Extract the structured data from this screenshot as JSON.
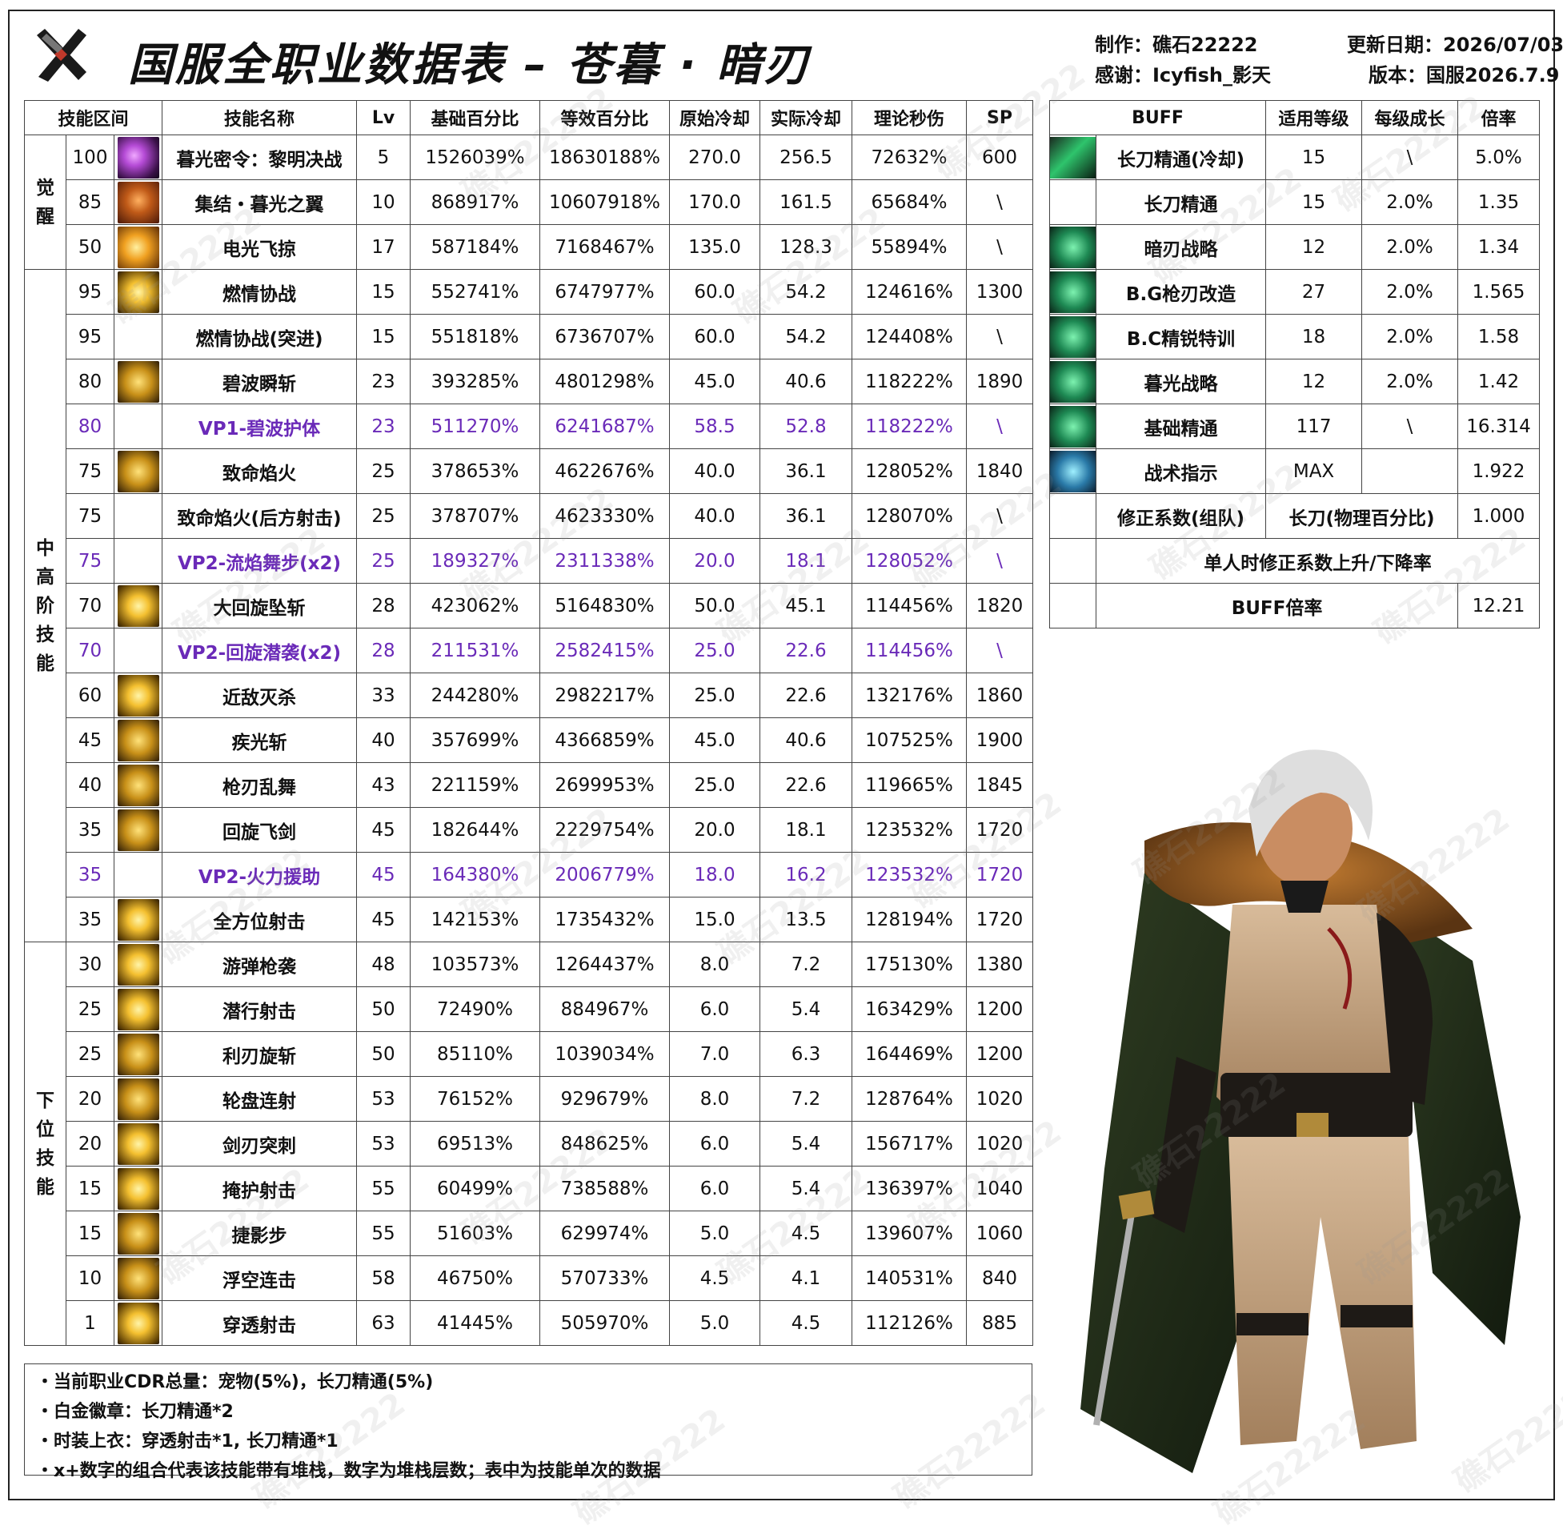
{
  "header": {
    "title": "国服全职业数据表 – 苍暮 · 暗刃",
    "author": "制作：礁石22222",
    "thanks": "感谢：Icyfish_影天",
    "update": "更新日期：2026/07/03",
    "version": "版本：国服2026.7.9"
  },
  "skills_table": {
    "headers": [
      "技能区间",
      "技能名称",
      "Lv",
      "基础百分比",
      "等效百分比",
      "原始冷却",
      "实际冷却",
      "理论秒伤",
      "SP"
    ],
    "groups": [
      {
        "label_chars": [
          "觉",
          "醒"
        ],
        "rows": 3
      },
      {
        "label_chars": [
          "中",
          "高",
          "阶",
          "技",
          "能"
        ],
        "rows": 15
      },
      {
        "label_chars": [
          "下",
          "位",
          "技",
          "能"
        ],
        "rows": 9
      }
    ],
    "rows": [
      {
        "level": "100",
        "icon": "sk1",
        "name": "暮光密令：黎明决战",
        "lv": "5",
        "base": "1526039%",
        "equiv": "18630188%",
        "cd": "270.0",
        "real_cd": "256.5",
        "dps": "72632%",
        "sp": "600",
        "vp": false
      },
      {
        "level": "85",
        "icon": "sk2",
        "name": "集结・暮光之翼",
        "lv": "10",
        "base": "868917%",
        "equiv": "10607918%",
        "cd": "170.0",
        "real_cd": "161.5",
        "dps": "65684%",
        "sp": "\\",
        "vp": false
      },
      {
        "level": "50",
        "icon": "sk3",
        "name": "电光飞掠",
        "lv": "17",
        "base": "587184%",
        "equiv": "7168467%",
        "cd": "135.0",
        "real_cd": "128.3",
        "dps": "55894%",
        "sp": "\\",
        "vp": false
      },
      {
        "level": "95",
        "icon": "sk4",
        "name": "燃情协战",
        "lv": "15",
        "base": "552741%",
        "equiv": "6747977%",
        "cd": "60.0",
        "real_cd": "54.2",
        "dps": "124616%",
        "sp": "1300",
        "vp": false
      },
      {
        "level": "95",
        "icon": "",
        "name": "燃情协战(突进)",
        "lv": "15",
        "base": "551818%",
        "equiv": "6736707%",
        "cd": "60.0",
        "real_cd": "54.2",
        "dps": "124408%",
        "sp": "\\",
        "vp": false
      },
      {
        "level": "80",
        "icon": "sk5",
        "name": "碧波瞬斩",
        "lv": "23",
        "base": "393285%",
        "equiv": "4801298%",
        "cd": "45.0",
        "real_cd": "40.6",
        "dps": "118222%",
        "sp": "1890",
        "vp": false
      },
      {
        "level": "80",
        "icon": "",
        "name": "VP1-碧波护体",
        "lv": "23",
        "base": "511270%",
        "equiv": "6241687%",
        "cd": "58.5",
        "real_cd": "52.8",
        "dps": "118222%",
        "sp": "\\",
        "vp": true
      },
      {
        "level": "75",
        "icon": "sk5",
        "name": "致命焰火",
        "lv": "25",
        "base": "378653%",
        "equiv": "4622676%",
        "cd": "40.0",
        "real_cd": "36.1",
        "dps": "128052%",
        "sp": "1840",
        "vp": false
      },
      {
        "level": "75",
        "icon": "",
        "name": "致命焰火(后方射击)",
        "lv": "25",
        "base": "378707%",
        "equiv": "4623330%",
        "cd": "40.0",
        "real_cd": "36.1",
        "dps": "128070%",
        "sp": "\\",
        "vp": false
      },
      {
        "level": "75",
        "icon": "",
        "name": "VP2-流焰舞步(x2)",
        "lv": "25",
        "base": "189327%",
        "equiv": "2311338%",
        "cd": "20.0",
        "real_cd": "18.1",
        "dps": "128052%",
        "sp": "\\",
        "vp": true
      },
      {
        "level": "70",
        "icon": "sk4",
        "name": "大回旋坠斩",
        "lv": "28",
        "base": "423062%",
        "equiv": "5164830%",
        "cd": "50.0",
        "real_cd": "45.1",
        "dps": "114456%",
        "sp": "1820",
        "vp": false
      },
      {
        "level": "70",
        "icon": "",
        "name": "VP2-回旋潜袭(x2)",
        "lv": "28",
        "base": "211531%",
        "equiv": "2582415%",
        "cd": "25.0",
        "real_cd": "22.6",
        "dps": "114456%",
        "sp": "\\",
        "vp": true
      },
      {
        "level": "60",
        "icon": "sk4",
        "name": "近敌灭杀",
        "lv": "33",
        "base": "244280%",
        "equiv": "2982217%",
        "cd": "25.0",
        "real_cd": "22.6",
        "dps": "132176%",
        "sp": "1860",
        "vp": false
      },
      {
        "level": "45",
        "icon": "sk5",
        "name": "疾光斩",
        "lv": "40",
        "base": "357699%",
        "equiv": "4366859%",
        "cd": "45.0",
        "real_cd": "40.6",
        "dps": "107525%",
        "sp": "1900",
        "vp": false
      },
      {
        "level": "40",
        "icon": "sk5",
        "name": "枪刃乱舞",
        "lv": "43",
        "base": "221159%",
        "equiv": "2699953%",
        "cd": "25.0",
        "real_cd": "22.6",
        "dps": "119665%",
        "sp": "1845",
        "vp": false
      },
      {
        "level": "35",
        "icon": "sk5",
        "name": "回旋飞剑",
        "lv": "45",
        "base": "182644%",
        "equiv": "2229754%",
        "cd": "20.0",
        "real_cd": "18.1",
        "dps": "123532%",
        "sp": "1720",
        "vp": false
      },
      {
        "level": "35",
        "icon": "",
        "name": "VP2-火力援助",
        "lv": "45",
        "base": "164380%",
        "equiv": "2006779%",
        "cd": "18.0",
        "real_cd": "16.2",
        "dps": "123532%",
        "sp": "1720",
        "vp": true
      },
      {
        "level": "35",
        "icon": "sk4",
        "name": "全方位射击",
        "lv": "45",
        "base": "142153%",
        "equiv": "1735432%",
        "cd": "15.0",
        "real_cd": "13.5",
        "dps": "128194%",
        "sp": "1720",
        "vp": false
      },
      {
        "level": "30",
        "icon": "sk4",
        "name": "游弹枪袭",
        "lv": "48",
        "base": "103573%",
        "equiv": "1264437%",
        "cd": "8.0",
        "real_cd": "7.2",
        "dps": "175130%",
        "sp": "1380",
        "vp": false
      },
      {
        "level": "25",
        "icon": "sk4",
        "name": "潜行射击",
        "lv": "50",
        "base": "72490%",
        "equiv": "884967%",
        "cd": "6.0",
        "real_cd": "5.4",
        "dps": "163429%",
        "sp": "1200",
        "vp": false
      },
      {
        "level": "25",
        "icon": "sk5",
        "name": "利刃旋斩",
        "lv": "50",
        "base": "85110%",
        "equiv": "1039034%",
        "cd": "7.0",
        "real_cd": "6.3",
        "dps": "164469%",
        "sp": "1200",
        "vp": false
      },
      {
        "level": "20",
        "icon": "sk5",
        "name": "轮盘连射",
        "lv": "53",
        "base": "76152%",
        "equiv": "929679%",
        "cd": "8.0",
        "real_cd": "7.2",
        "dps": "128764%",
        "sp": "1020",
        "vp": false
      },
      {
        "level": "20",
        "icon": "sk4",
        "name": "剑刃突刺",
        "lv": "53",
        "base": "69513%",
        "equiv": "848625%",
        "cd": "6.0",
        "real_cd": "5.4",
        "dps": "156717%",
        "sp": "1020",
        "vp": false
      },
      {
        "level": "15",
        "icon": "sk4",
        "name": "掩护射击",
        "lv": "55",
        "base": "60499%",
        "equiv": "738588%",
        "cd": "6.0",
        "real_cd": "5.4",
        "dps": "136397%",
        "sp": "1040",
        "vp": false
      },
      {
        "level": "15",
        "icon": "sk5",
        "name": "捷影步",
        "lv": "55",
        "base": "51603%",
        "equiv": "629974%",
        "cd": "5.0",
        "real_cd": "4.5",
        "dps": "139607%",
        "sp": "1060",
        "vp": false
      },
      {
        "level": "10",
        "icon": "sk5",
        "name": "浮空连击",
        "lv": "58",
        "base": "46750%",
        "equiv": "570733%",
        "cd": "4.5",
        "real_cd": "4.1",
        "dps": "140531%",
        "sp": "840",
        "vp": false
      },
      {
        "level": "1",
        "icon": "sk4",
        "name": "穿透射击",
        "lv": "63",
        "base": "41445%",
        "equiv": "505970%",
        "cd": "5.0",
        "real_cd": "4.5",
        "dps": "112126%",
        "sp": "885",
        "vp": false
      }
    ]
  },
  "buff_table": {
    "headers": [
      "BUFF",
      "适用等级",
      "每级成长",
      "倍率"
    ],
    "rows": [
      {
        "icon": "bi1",
        "name": "长刀精通(冷却)",
        "level": "15",
        "growth": "\\",
        "rate": "5.0%"
      },
      {
        "icon": "",
        "name": "长刀精通",
        "level": "15",
        "growth": "2.0%",
        "rate": "1.35"
      },
      {
        "icon": "bi2",
        "name": "暗刃战略",
        "level": "12",
        "growth": "2.0%",
        "rate": "1.34"
      },
      {
        "icon": "bi2",
        "name": "B.G枪刃改造",
        "level": "27",
        "growth": "2.0%",
        "rate": "1.565"
      },
      {
        "icon": "bi2",
        "name": "B.C精锐特训",
        "level": "18",
        "growth": "2.0%",
        "rate": "1.58"
      },
      {
        "icon": "bi2",
        "name": "暮光战略",
        "level": "12",
        "growth": "2.0%",
        "rate": "1.42"
      },
      {
        "icon": "bi2",
        "name": "基础精通",
        "level": "117",
        "growth": "\\",
        "rate": "16.314"
      },
      {
        "icon": "bi3",
        "name": "战术指示",
        "level": "MAX",
        "growth": "",
        "rate": "1.922"
      }
    ],
    "correction_label": "修正系数(组队)",
    "correction_type": "长刀(物理百分比)",
    "correction_value": "1.000",
    "solo_note": "单人时修正系数上升/下降率",
    "buff_total_label": "BUFF倍率",
    "buff_total_value": "12.21"
  },
  "notes": [
    "・当前职业CDR总量：宠物(5%)，长刀精通(5%)",
    "・白金徽章：长刀精通*2",
    "・时装上衣：穿透射击*1, 长刀精通*1",
    "・x+数字的组合代表该技能带有堆栈，数字为堆栈层数；表中为技能单次的数据"
  ],
  "watermark": "礁石22222",
  "colors": {
    "vp_text": "#6a2ab8",
    "border": "#444444"
  }
}
